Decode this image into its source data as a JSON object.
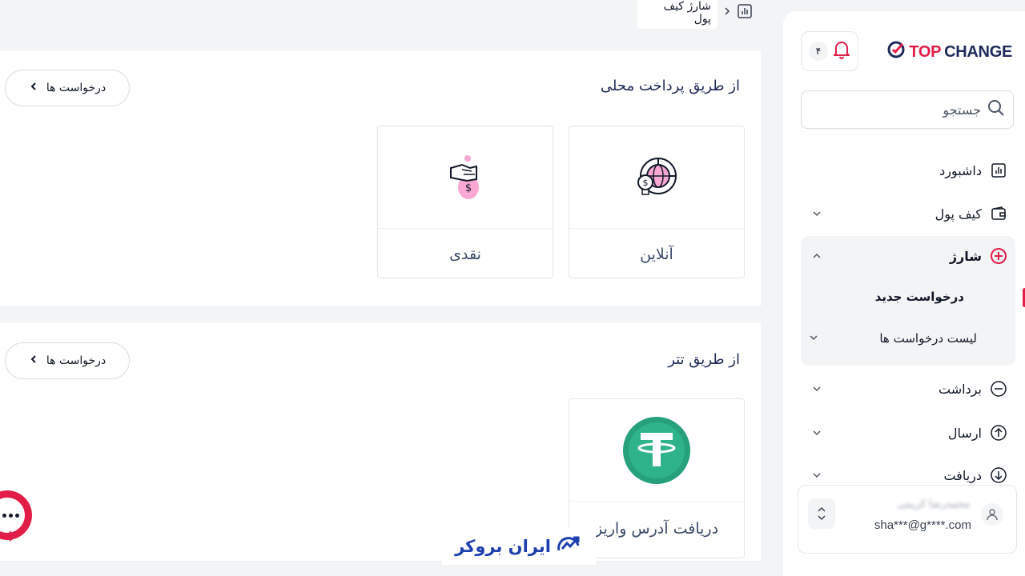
{
  "breadcrumb": {
    "current": "شارژ کیف پول"
  },
  "panels": {
    "local": {
      "title": "از طریق پرداخت محلی",
      "requests_label": "درخواست ها",
      "methods": [
        {
          "label": "آنلاین",
          "icon": "globe-dollar-icon"
        },
        {
          "label": "نقدی",
          "icon": "cash-hand-icon"
        }
      ]
    },
    "tether": {
      "title": "از طریق تتر",
      "requests_label": "درخواست ها",
      "methods": [
        {
          "label": "دریافت آدرس واریز",
          "icon": "tether-icon"
        }
      ]
    }
  },
  "sidebar": {
    "logo": {
      "top": "TOP",
      "change": "CHANGE"
    },
    "notifications_count": "۴",
    "search_placeholder": "جستجو",
    "nav": {
      "dashboard": "داشبورد",
      "wallet": "کیف پول",
      "charge": "شارژ",
      "new_request": "درخواست جدید",
      "request_list": "لیست درخواست ها",
      "withdraw": "برداشت",
      "send": "ارسال",
      "receive": "دریافت"
    },
    "profile": {
      "name": "محمدرضا کریمی",
      "email": "sha***@g****.com"
    }
  },
  "watermark": {
    "text": "ایران بروکر"
  },
  "colors": {
    "accent": "#e11d48",
    "navy": "#1e2a5a",
    "tether": "#26a17b"
  }
}
